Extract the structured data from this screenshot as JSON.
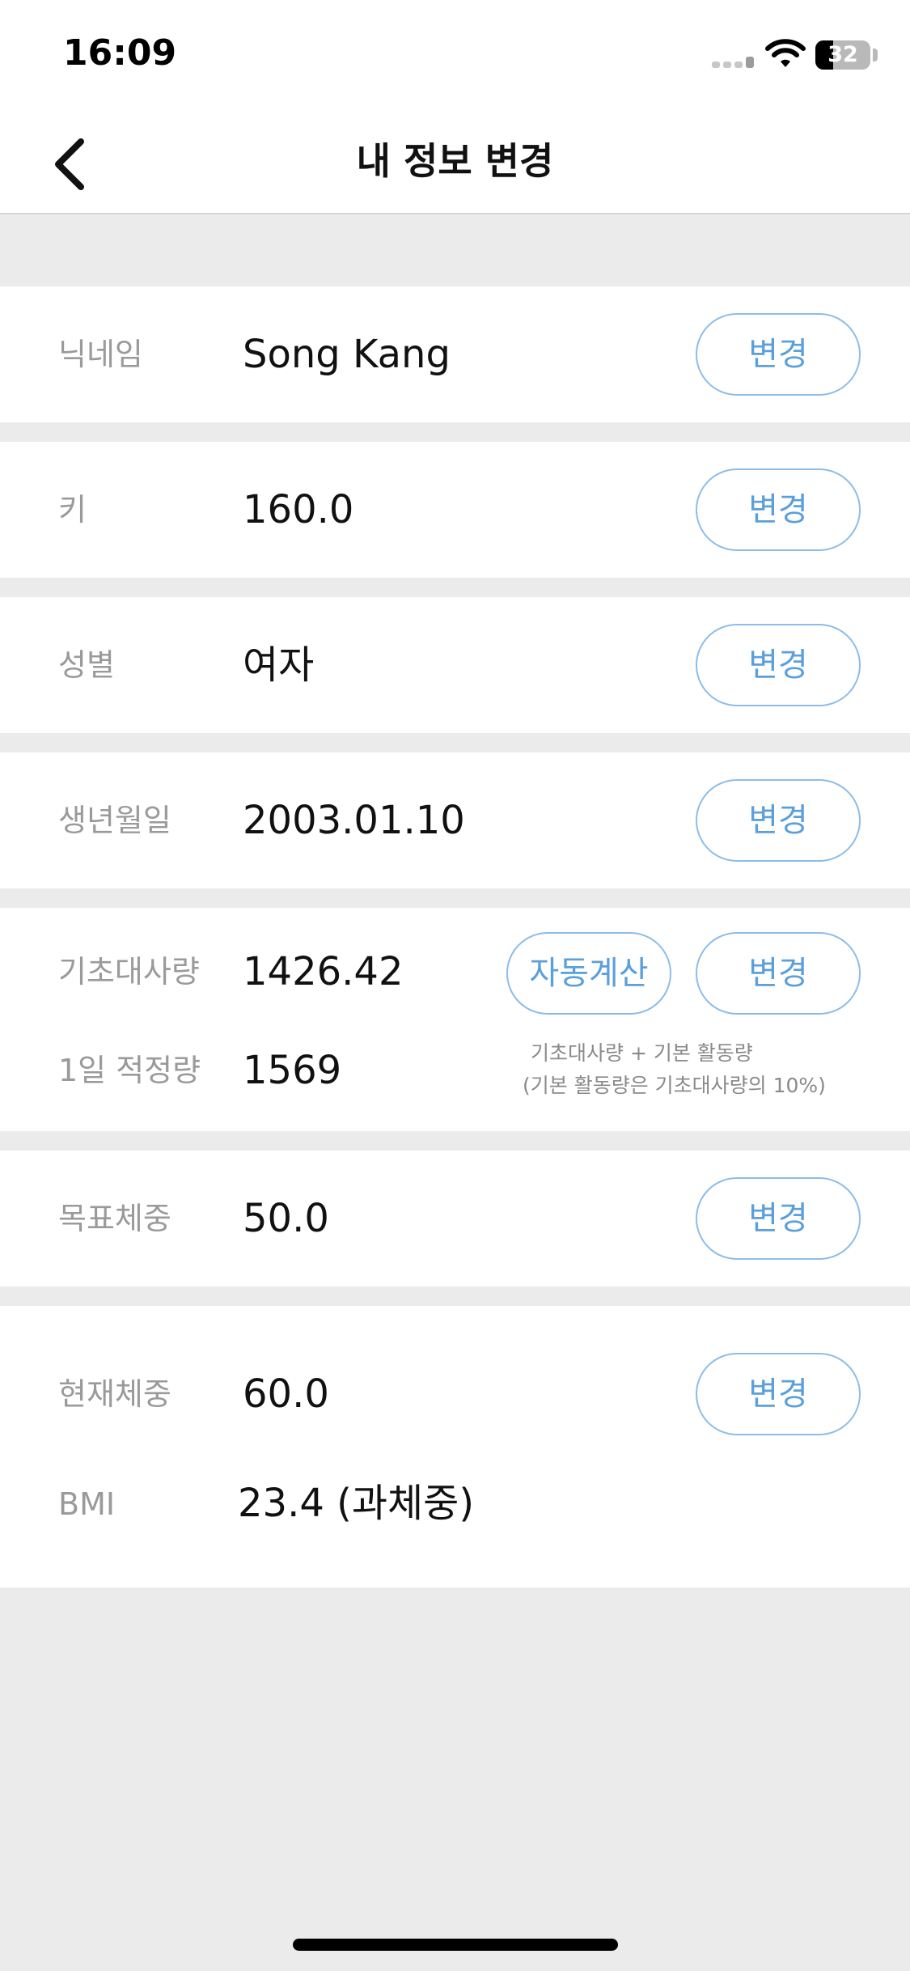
{
  "status_bar": {
    "time": "16:09",
    "battery": "32",
    "battery_level_percent": 32
  },
  "nav": {
    "title": "내 정보 변경"
  },
  "rows": {
    "nickname": {
      "label": "닉네임",
      "value": "Song Kang",
      "button": "변경"
    },
    "height": {
      "label": "키",
      "value": "160.0",
      "button": "변경"
    },
    "gender": {
      "label": "성별",
      "value": "여자",
      "button": "변경"
    },
    "birthdate": {
      "label": "생년월일",
      "value": "2003.01.10",
      "button": "변경"
    },
    "bmr": {
      "label": "기초대사량",
      "value": "1426.42",
      "auto_button": "자동계산",
      "button": "변경",
      "daily_label": "1일 적정량",
      "daily_value": "1569",
      "note_line1": "기초대사량 + 기본 활동량",
      "note_line2": "(기본 활동량은 기초대사량의 10%)"
    },
    "target_weight": {
      "label": "목표체중",
      "value": "50.0",
      "button": "변경"
    },
    "current_weight": {
      "label": "현재체중",
      "value": "60.0",
      "button": "변경",
      "bmi_label": "BMI",
      "bmi_value": "23.4 (과체중)"
    }
  },
  "colors": {
    "accent": "#5b9fdc",
    "accent_border": "#8cbde8",
    "background": "#ebebeb",
    "label": "#9a9a9a"
  }
}
